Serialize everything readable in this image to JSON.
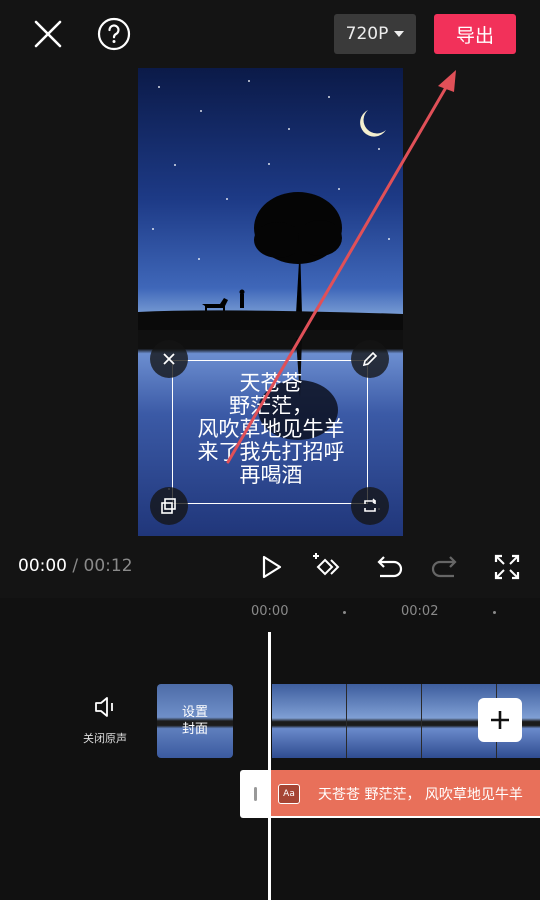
{
  "topbar": {
    "resolution": "720P",
    "export_label": "导出"
  },
  "preview": {
    "subtitle_lines": [
      "天苍苍",
      "野茫茫，",
      "风吹草地见牛羊",
      "来了我先打招呼",
      "再喝酒"
    ]
  },
  "playback": {
    "current_time": "00:00",
    "separator": "/",
    "total_time": "00:12"
  },
  "timeline": {
    "ticks": [
      "00:00",
      "00:02"
    ],
    "mute_label": "关闭原声",
    "cover_label_line1": "设置",
    "cover_label_line2": "封面",
    "text_clip_icon": "Aa",
    "text_clip_content": "天苍苍 野茫茫， 风吹草地见牛羊"
  },
  "icons": {
    "close": "close-icon",
    "help": "help-icon",
    "play": "play-icon",
    "keyframe": "keyframe-icon",
    "undo": "undo-icon",
    "redo": "redo-icon",
    "fullscreen": "fullscreen-icon",
    "speaker": "speaker-icon",
    "add": "plus-icon"
  },
  "colors": {
    "export": "#f2315a",
    "text_track": "#e8705a",
    "arrow": "#e05058"
  }
}
